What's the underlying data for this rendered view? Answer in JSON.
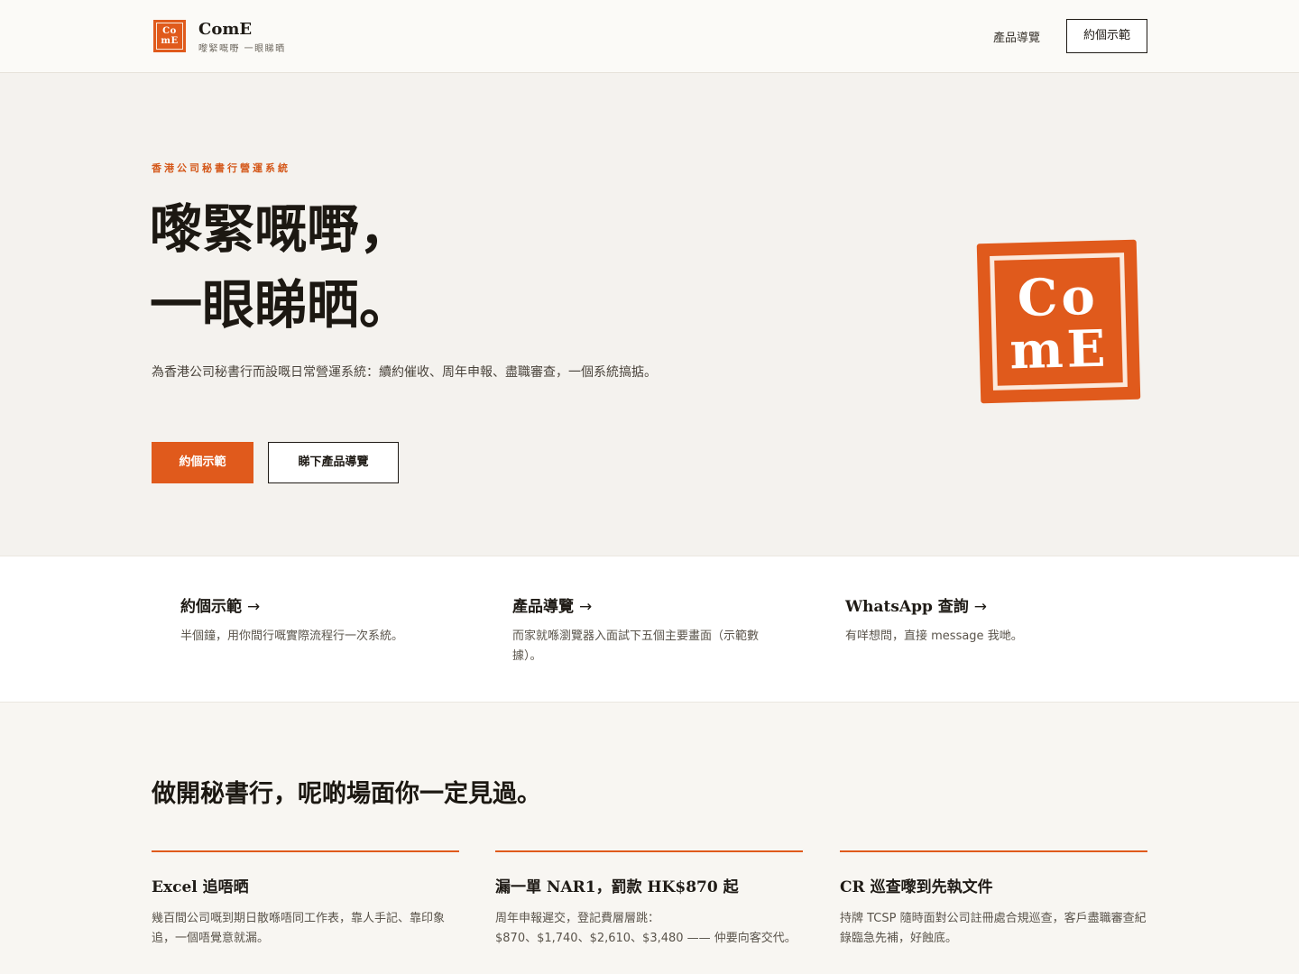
{
  "header": {
    "logo_mark_line1": "Co",
    "logo_mark_line2": "mE",
    "brand_name": "ComE",
    "brand_tagline": "嚟緊嘅嘢 一眼睇晒",
    "nav_link": "產品導覽",
    "nav_cta": "約個示範"
  },
  "hero": {
    "eyebrow": "香港公司秘書行營運系統",
    "title_line1": "嚟緊嘅嘢，",
    "title_line2": "一眼睇晒。",
    "description": "為香港公司秘書行而設嘅日常營運系統：續約催收、周年申報、盡職審查，一個系統搞掂。",
    "primary_button": "約個示範",
    "secondary_button": "睇下產品導覽",
    "logo_line1": "Co",
    "logo_line2": "mE"
  },
  "links": [
    {
      "title": "約個示範",
      "arrow": "→",
      "desc": "半個鐘，用你間行嘅實際流程行一次系統。"
    },
    {
      "title": "產品導覽",
      "arrow": "→",
      "desc": "而家就喺瀏覽器入面試下五個主要畫面（示範數據）。"
    },
    {
      "title": "WhatsApp 查詢",
      "arrow": "→",
      "desc": "有咩想問，直接 message 我哋。"
    }
  ],
  "pain_section": {
    "title": "做開秘書行，呢啲場面你一定見過。",
    "cards": [
      {
        "title": "Excel 追唔晒",
        "desc": "幾百間公司嘅到期日散喺唔同工作表，靠人手記、靠印象追，一個唔覺意就漏。"
      },
      {
        "title": "漏一單 NAR1，罰款 HK$870 起",
        "desc": "周年申報遲交，登記費層層跳：$870、$1,740、$2,610、$3,480 —— 仲要向客交代。"
      },
      {
        "title": "CR 巡查嚟到先執文件",
        "desc": "持牌 TCSP 隨時面對公司註冊處合規巡查，客戶盡職審查紀錄臨急先補，好蝕底。"
      }
    ]
  },
  "colors": {
    "accent": "#e05a1c",
    "text": "#1f1b16",
    "background": "#f8f6f2"
  }
}
